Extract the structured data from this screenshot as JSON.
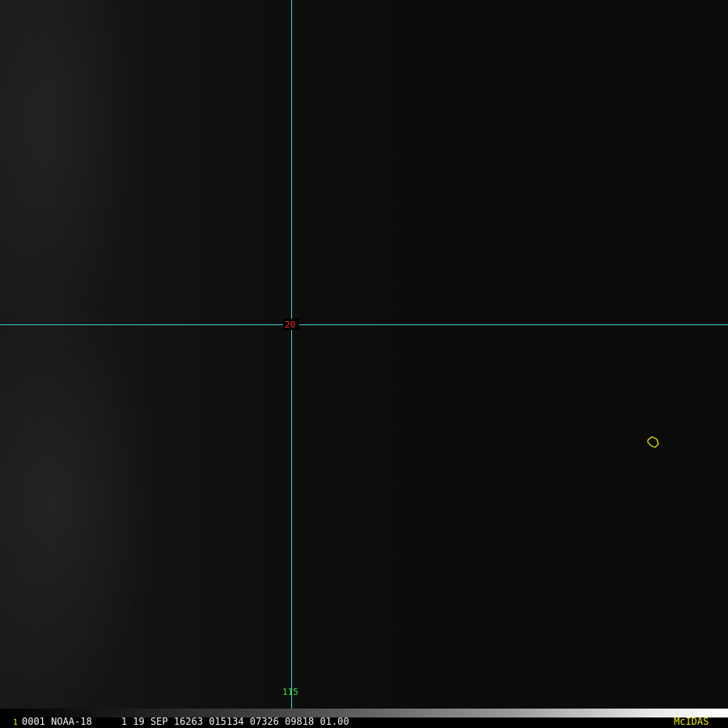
{
  "grid": {
    "latitude_label": "20",
    "longitude_label": "115"
  },
  "status_bar": {
    "frame_number": "1",
    "info_text": "0001 NOAA-18     1 19 SEP 16263 015134 07326 09818 01.00",
    "software_label": "McIDAS"
  },
  "colors": {
    "grid_lines": "#3fd0d0",
    "latitude_label": "#ff2a2a",
    "longitude_label": "#3ee03e",
    "coastline": "#f0f000",
    "software_label": "#f0f000"
  }
}
